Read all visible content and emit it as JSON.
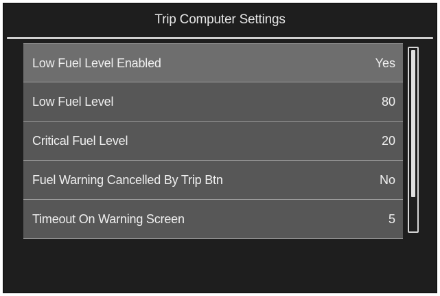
{
  "header": {
    "title": "Trip Computer Settings"
  },
  "settings": [
    {
      "label": "Low Fuel Level Enabled",
      "value": "Yes",
      "selected": true
    },
    {
      "label": "Low Fuel Level",
      "value": "80"
    },
    {
      "label": "Critical Fuel Level",
      "value": "20"
    },
    {
      "label": "Fuel Warning Cancelled By Trip Btn",
      "value": "No"
    },
    {
      "label": "Timeout On Warning Screen",
      "value": "5"
    }
  ],
  "scrollbar": {
    "visible_fraction": 0.82,
    "position": 0
  },
  "colors": {
    "screen_background": "#1e1e1e",
    "row_background": "#575757",
    "selected_row_background": "#6e6e6e",
    "text": "#f0f0f0"
  }
}
